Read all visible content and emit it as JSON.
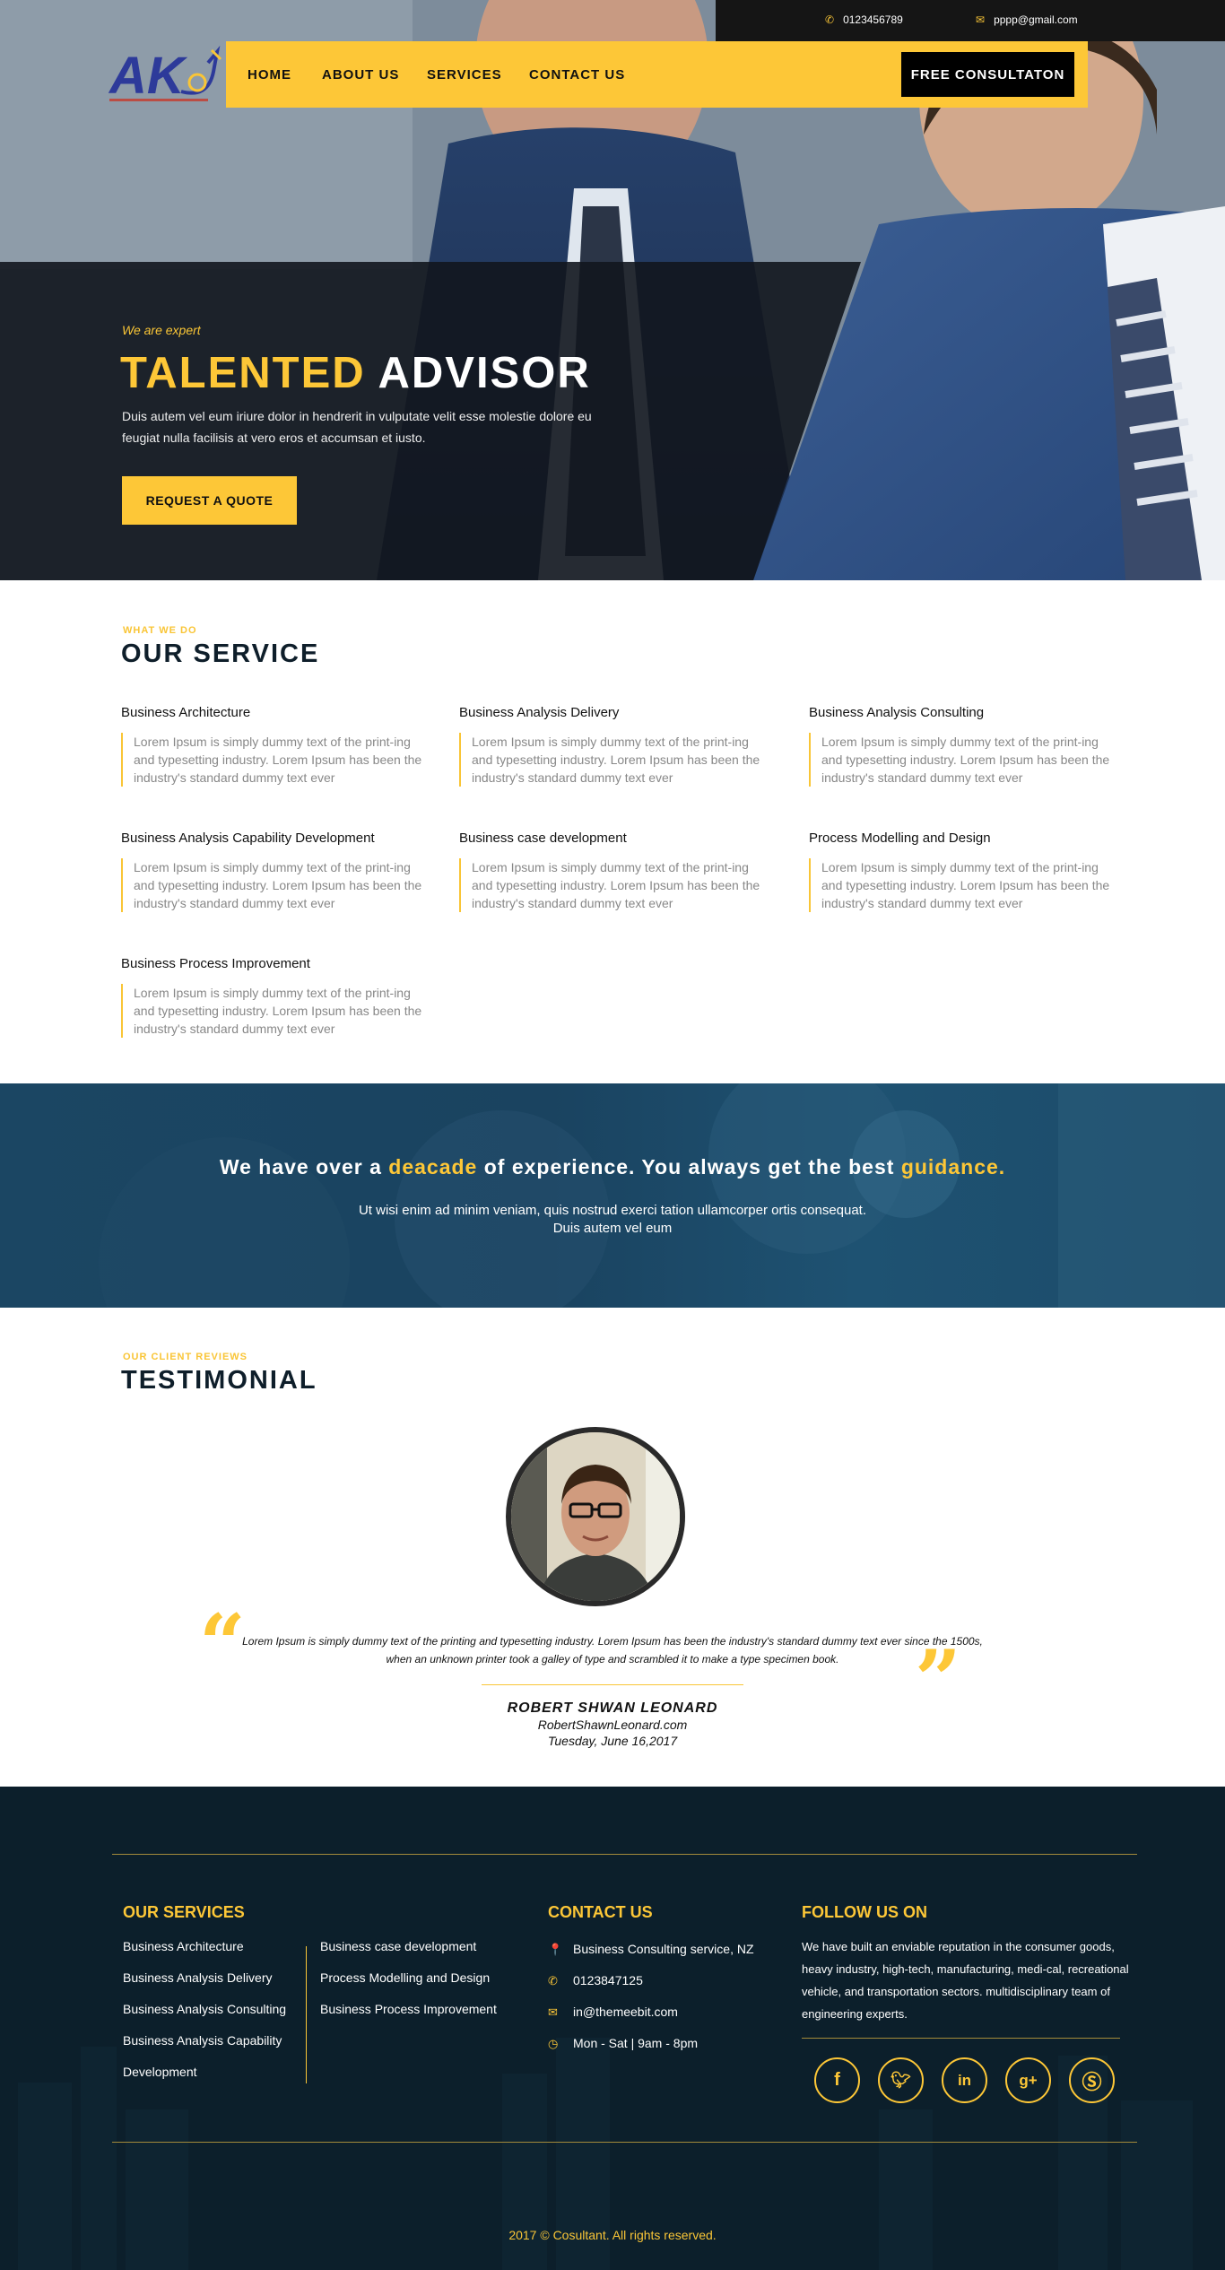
{
  "topbar": {
    "phone_icon": "phone-icon",
    "phone": "0123456789",
    "email_icon": "envelope-icon",
    "email": "pppp@gmail.com"
  },
  "logo": {
    "text": "AK"
  },
  "nav": {
    "items": [
      "HOME",
      "ABOUT US",
      "SERVICES",
      "CONTACT US"
    ],
    "cta": "FREE CONSULTATON"
  },
  "hero": {
    "eyebrow": "We are expert",
    "title_highlight": "TALENTED",
    "title_rest": "ADVISOR",
    "description": "Duis autem vel eum iriure dolor in hendrerit in vulputate velit esse molestie dolore eu feugiat nulla facilisis at vero eros et accumsan et iusto.",
    "button": "REQUEST A QUOTE"
  },
  "services": {
    "eyebrow": "WHAT WE DO",
    "title": "OUR SERVICE",
    "items": [
      {
        "title": "Business Architecture",
        "text": "Lorem Ipsum is simply dummy text of the print-ing and typesetting industry. Lorem Ipsum has been the industry's standard dummy text ever"
      },
      {
        "title": "Business Analysis Delivery",
        "text": "Lorem Ipsum is simply dummy text of the print-ing and typesetting industry. Lorem Ipsum has been the industry's standard dummy text ever"
      },
      {
        "title": "Business Analysis Consulting",
        "text": "Lorem Ipsum is simply dummy text of the print-ing and typesetting industry. Lorem Ipsum has been the industry's standard dummy text ever"
      },
      {
        "title": "Business Analysis Capability Development",
        "text": "Lorem Ipsum is simply dummy text of the print-ing and typesetting industry. Lorem Ipsum has been the industry's standard dummy text ever"
      },
      {
        "title": "Business case development",
        "text": "Lorem Ipsum is simply dummy text of the print-ing and typesetting industry. Lorem Ipsum has been the industry's standard dummy text ever"
      },
      {
        "title": "Process Modelling and Design",
        "text": "Lorem Ipsum is simply dummy text of the print-ing and typesetting industry. Lorem Ipsum has been the industry's standard dummy text ever"
      },
      {
        "title": "Business Process Improvement",
        "text": "Lorem Ipsum is simply dummy text of the print-ing and typesetting industry. Lorem Ipsum has been the industry's standard dummy text ever"
      }
    ]
  },
  "banner": {
    "h_part1": "We have over a ",
    "h_highlight1": "deacade",
    "h_part2": " of experience. You always get the best ",
    "h_highlight2": "guidance.",
    "text": "Ut wisi enim ad minim veniam, quis nostrud exerci tation ullamcorper ortis consequat. Duis autem vel eum"
  },
  "testimonial": {
    "eyebrow": "OUR CLIENT REVIEWS",
    "title": "TESTIMONIAL",
    "quote": "Lorem Ipsum is simply dummy text of the printing and typesetting industry. Lorem Ipsum has been the industry's standard dummy text ever since the 1500s, when an unknown printer took a galley of type and scrambled it to make a type specimen book.",
    "name": "ROBERT SHWAN LEONARD",
    "website": "RobertShawnLeonard.com",
    "date": "Tuesday, June 16,2017"
  },
  "footer": {
    "services_title": "OUR SERVICES",
    "services_col1": [
      "Business Architecture",
      "Business Analysis Delivery",
      "Business Analysis Consulting",
      "Business Analysis Capability",
      "Development"
    ],
    "services_col2": [
      "Business case development",
      "Process Modelling and Design",
      "Business Process Improvement"
    ],
    "contact_title": "CONTACT US",
    "contact": [
      {
        "icon": "map-pin-icon",
        "text": "Business Consulting service, NZ"
      },
      {
        "icon": "phone-icon",
        "text": "0123847125"
      },
      {
        "icon": "envelope-icon",
        "text": "in@themeebit.com"
      },
      {
        "icon": "clock-icon",
        "text": "Mon - Sat | 9am - 8pm"
      }
    ],
    "follow_title": "FOLLOW US ON",
    "follow_text": "We have built an enviable reputation in the consumer goods, heavy industry, high-tech, manufacturing, medi-cal, recreational vehicle, and transportation sectors. multidisciplinary team of engineering experts.",
    "social": [
      "facebook-icon",
      "twitter-icon",
      "linkedin-icon",
      "google-plus-icon",
      "skype-icon"
    ],
    "copyright": "2017 © Cosultant. All rights reserved."
  },
  "colors": {
    "accent": "#fdc737",
    "dark": "#0c1f2b",
    "banner": "#1b4663"
  }
}
